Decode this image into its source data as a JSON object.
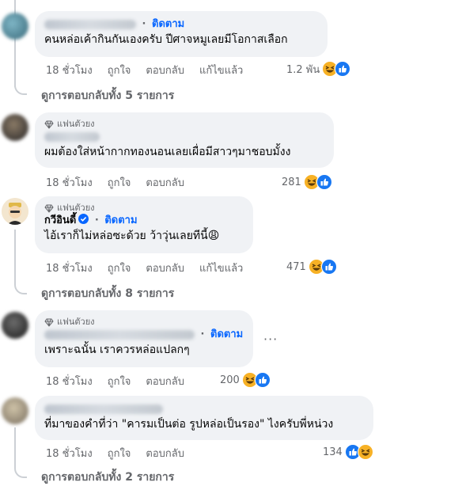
{
  "comments": [
    {
      "follow_label": "ติดตาม",
      "text": "คนหล่อเค้ากินกันเองครับ ปีศาจหมูเลยมีโอกาสเลือก",
      "time": "18 ชั่วโมง",
      "like_label": "ถูกใจ",
      "reply_label": "ตอบกลับ",
      "edited_label": "แก้ไขแล้ว",
      "reaction_count": "1.2 พัน"
    },
    {
      "badge": "แฟนตัวยง",
      "text": "ผมต้องใส่หน้ากากทองนอนเลยเผื่อมีสาวๆมาชอบมั้งง",
      "time": "18 ชั่วโมง",
      "like_label": "ถูกใจ",
      "reply_label": "ตอบกลับ",
      "reaction_count": "281"
    },
    {
      "badge": "แฟนตัวยง",
      "name": "กวีอินดี้",
      "follow_label": "ติดตาม",
      "text": "ไอ้เราก็ไม่หล่อซะด้วย ว้าวุ่นเลยทีนี้😩",
      "time": "18 ชั่วโมง",
      "like_label": "ถูกใจ",
      "reply_label": "ตอบกลับ",
      "edited_label": "แก้ไขแล้ว",
      "reaction_count": "471"
    },
    {
      "badge": "แฟนตัวยง",
      "follow_label": "ติดตาม",
      "more": "···",
      "text": "เพราะฉนั้น เราควรหล่อแปลกๆ",
      "time": "18 ชั่วโมง",
      "like_label": "ถูกใจ",
      "reply_label": "ตอบกลับ",
      "reaction_count": "200"
    },
    {
      "text": "ที่มาของคำที่ว่า \"คารมเป็นต่อ รูปหล่อเป็นรอง\" ไงครับพี่หน่วง",
      "time": "18 ชั่วโมง",
      "like_label": "ถูกใจ",
      "reply_label": "ตอบกลับ",
      "reaction_count": "134"
    }
  ],
  "view_replies": [
    "ดูการตอบกลับทั้ง 5 รายการ",
    "ดูการตอบกลับทั้ง 8 รายการ",
    "ดูการตอบกลับทั้ง 2 รายการ"
  ],
  "colors": {
    "bubble": "#f0f2f5",
    "link_blue": "#0866ff",
    "meta_gray": "#65676b",
    "like_blue": "#1877f2",
    "haha_yellow": "#f7b125"
  },
  "icons": [
    "diamond-icon",
    "verified-badge-icon",
    "haha-reaction-icon",
    "like-reaction-icon"
  ]
}
